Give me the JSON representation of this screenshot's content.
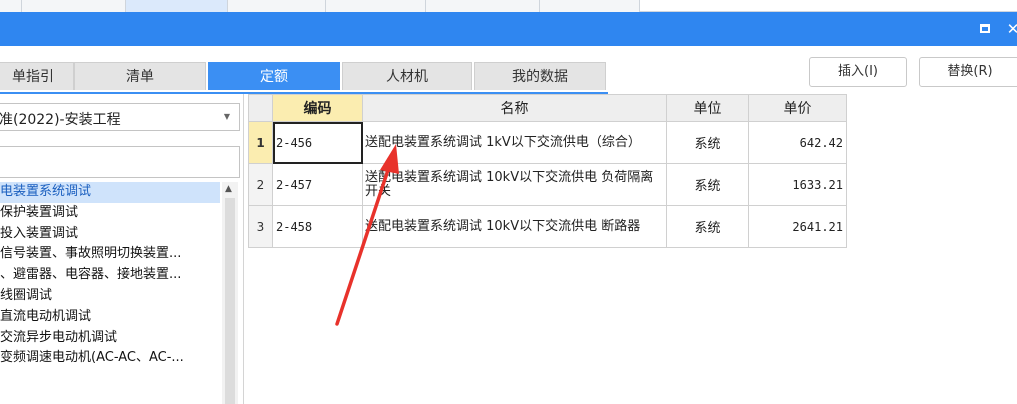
{
  "window": {
    "maximize_icon": "maximize-icon",
    "close_icon": "close-icon",
    "accent_color": "#2f86f0"
  },
  "tabs": [
    {
      "label": "单指引"
    },
    {
      "label": "清单"
    },
    {
      "label": "定额"
    },
    {
      "label": "人材机"
    },
    {
      "label": "我的数据"
    }
  ],
  "actions": {
    "insert_label": "插入(I)",
    "replace_label": "替换(R)"
  },
  "left_panel": {
    "library_select_value": "准(2022)-安装工程",
    "search_value": "",
    "tree_items": [
      {
        "label": "电装置系统调试"
      },
      {
        "label": "保护装置调试"
      },
      {
        "label": "投入装置调试"
      },
      {
        "label": "信号装置、事故照明切换装置..."
      },
      {
        "label": "、避雷器、电容器、接地装置..."
      },
      {
        "label": "线圈调试"
      },
      {
        "label": "直流电动机调试"
      },
      {
        "label": "交流异步电动机调试"
      },
      {
        "label": "变频调速电动机(AC-AC、AC-..."
      }
    ]
  },
  "grid": {
    "headers": {
      "code": "编码",
      "name": "名称",
      "unit": "单位",
      "price": "单价"
    },
    "rows": [
      {
        "no": "1",
        "code": "2-456",
        "name": "送配电装置系统调试 1kV以下交流供电（综合）",
        "unit": "系统",
        "price": "642.42"
      },
      {
        "no": "2",
        "code": "2-457",
        "name": "送配电装置系统调试 10kV以下交流供电 负荷隔离开关",
        "unit": "系统",
        "price": "1633.21"
      },
      {
        "no": "3",
        "code": "2-458",
        "name": "送配电装置系统调试 10kV以下交流供电 断路器",
        "unit": "系统",
        "price": "2641.21"
      }
    ]
  }
}
